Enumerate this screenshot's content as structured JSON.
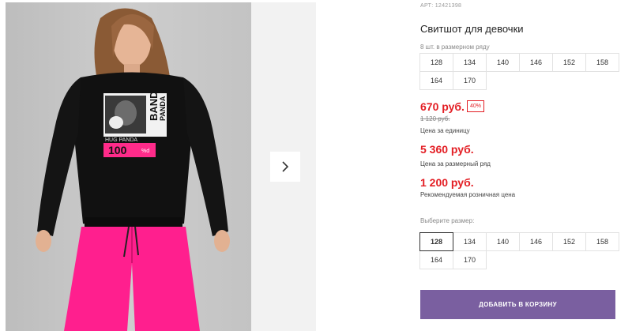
{
  "product": {
    "sku": "АРТ: 12421398",
    "title": "Свитшот для девочки",
    "print": {
      "band": "BAND",
      "panda": "PANDA",
      "hug_panda": "HUG PANDA",
      "number": "100",
      "suffix": "%d"
    }
  },
  "row_sizes": {
    "label": "8 шт. в размерном ряду",
    "items": [
      "128",
      "134",
      "140",
      "146",
      "152",
      "158",
      "164",
      "170"
    ]
  },
  "pricing": {
    "price": "670 руб.",
    "discount": "40%",
    "old_price": "1 120 руб.",
    "price_caption": "Цена за единицу",
    "row_price": "5 360 руб.",
    "row_price_caption": "Цена за размерный ряд",
    "retail_price": "1 200 руб.",
    "retail_price_caption": "Рекомендуемая розничная цена"
  },
  "size_select": {
    "label": "Выберите размер:",
    "selected": "128",
    "items": [
      "128",
      "134",
      "140",
      "146",
      "152",
      "158",
      "164",
      "170"
    ]
  },
  "cart_button": {
    "label": "ДОБАВИТЬ В КОРЗИНУ"
  },
  "gallery": {
    "next_icon": "chevron-right-icon"
  },
  "colors": {
    "accent_purple": "#7a5fa0",
    "price_red": "#e31e24",
    "sweatshirt": "#111111",
    "pants": "#ff1f8e",
    "print_pink": "#ff2b8a"
  }
}
